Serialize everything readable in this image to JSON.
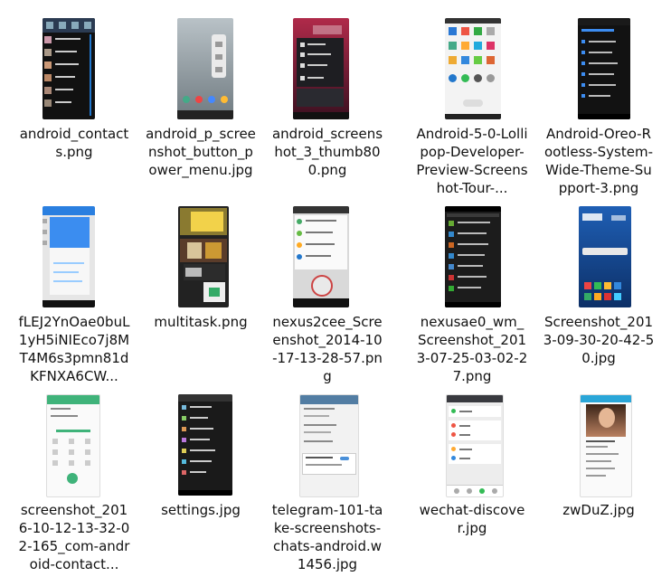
{
  "files": [
    {
      "label": "android_contacts.png"
    },
    {
      "label": "android_p_screenshot_button_power_menu.jpg"
    },
    {
      "label": "android_screenshot_3_thumb800.png"
    },
    {
      "label": "Android-5-0-Lollipop-Developer-Preview-Screenshot-Tour-..."
    },
    {
      "label": "Android-Oreo-Rootless-System-Wide-Theme-Support-3.png"
    },
    {
      "label": "fLEJ2YnOae0buL1yH5iNIEco7j8MT4M6s3pmn81dKFNXA6CW..."
    },
    {
      "label": "multitask.png"
    },
    {
      "label": "nexus2cee_Screenshot_2014-10-17-13-28-57.png"
    },
    {
      "label": "nexusae0_wm_Screenshot_2013-07-25-03-02-27.png"
    },
    {
      "label": "Screenshot_2013-09-30-20-42-50.jpg"
    },
    {
      "label": "screenshot_2016-10-12-13-32-02-165_com-android-contact..."
    },
    {
      "label": "settings.jpg"
    },
    {
      "label": "telegram-101-take-screenshots-chats-android.w1456.jpg"
    },
    {
      "label": "wechat-discover.jpg"
    },
    {
      "label": "zwDuZ.jpg"
    }
  ]
}
